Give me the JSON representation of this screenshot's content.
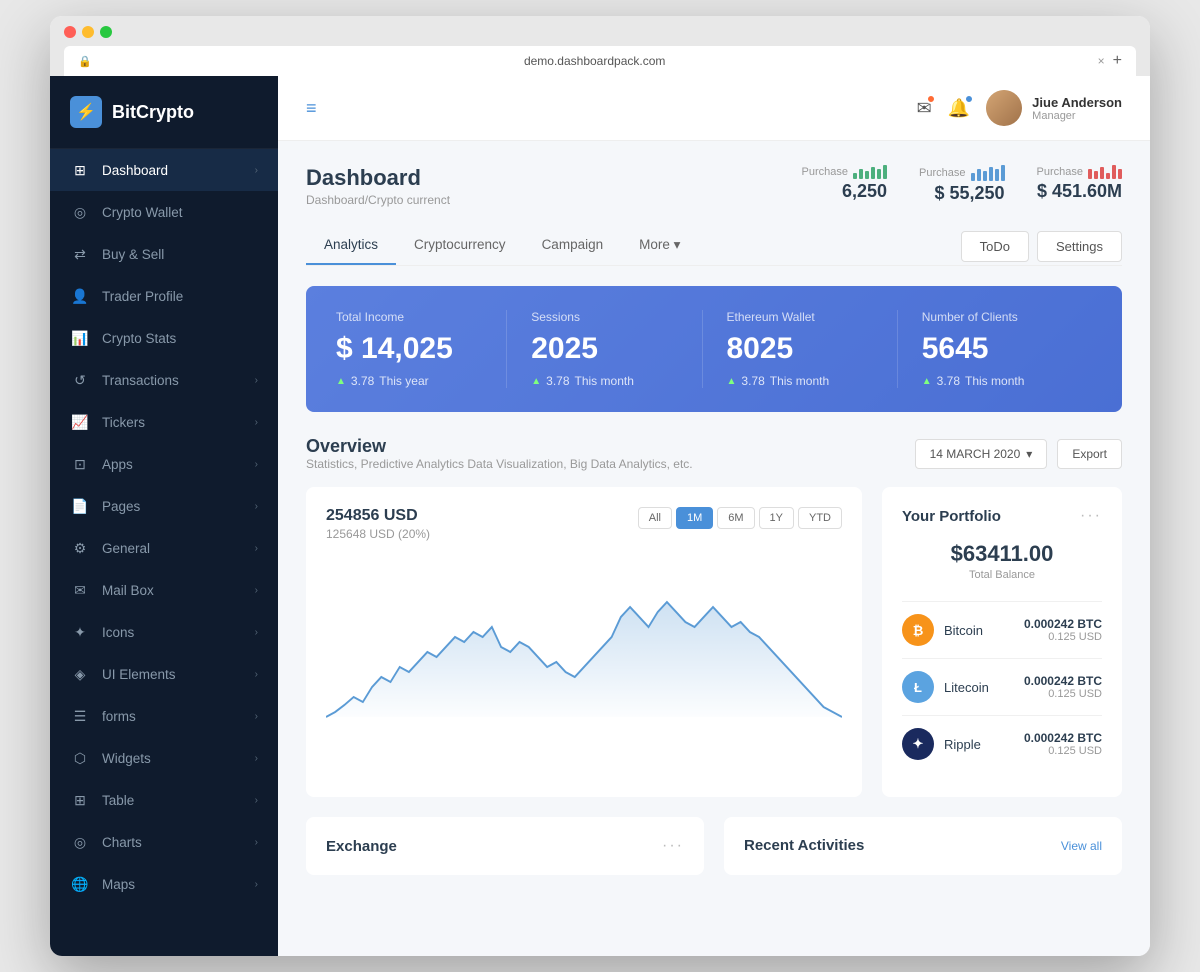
{
  "browser": {
    "url": "demo.dashboardpack.com",
    "close_char": "×",
    "plus_char": "+"
  },
  "sidebar": {
    "logo_text": "BitCrypto",
    "logo_letter": "⚡",
    "items": [
      {
        "id": "dashboard",
        "label": "Dashboard",
        "icon": "⊞",
        "has_arrow": true,
        "active": true
      },
      {
        "id": "crypto-wallet",
        "label": "Crypto Wallet",
        "icon": "◎",
        "has_arrow": false,
        "active": false
      },
      {
        "id": "buy-sell",
        "label": "Buy & Sell",
        "icon": "⇄",
        "has_arrow": false,
        "active": false
      },
      {
        "id": "trader-profile",
        "label": "Trader Profile",
        "icon": "👤",
        "has_arrow": false,
        "active": false
      },
      {
        "id": "crypto-stats",
        "label": "Crypto Stats",
        "icon": "📊",
        "has_arrow": false,
        "active": false
      },
      {
        "id": "transactions",
        "label": "Transactions",
        "icon": "↺",
        "has_arrow": true,
        "active": false
      },
      {
        "id": "tickers",
        "label": "Tickers",
        "icon": "📈",
        "has_arrow": true,
        "active": false
      },
      {
        "id": "apps",
        "label": "Apps",
        "icon": "⊡",
        "has_arrow": true,
        "active": false
      },
      {
        "id": "pages",
        "label": "Pages",
        "icon": "📄",
        "has_arrow": true,
        "active": false
      },
      {
        "id": "general",
        "label": "General",
        "icon": "⚙",
        "has_arrow": true,
        "active": false
      },
      {
        "id": "mail-box",
        "label": "Mail Box",
        "icon": "✉",
        "has_arrow": true,
        "active": false
      },
      {
        "id": "icons",
        "label": "Icons",
        "icon": "✦",
        "has_arrow": true,
        "active": false
      },
      {
        "id": "ui-elements",
        "label": "UI Elements",
        "icon": "◈",
        "has_arrow": true,
        "active": false
      },
      {
        "id": "forms",
        "label": "forms",
        "icon": "☰",
        "has_arrow": true,
        "active": false
      },
      {
        "id": "widgets",
        "label": "Widgets",
        "icon": "⬡",
        "has_arrow": true,
        "active": false
      },
      {
        "id": "table",
        "label": "Table",
        "icon": "⊞",
        "has_arrow": true,
        "active": false
      },
      {
        "id": "charts",
        "label": "Charts",
        "icon": "◎",
        "has_arrow": true,
        "active": false
      },
      {
        "id": "maps",
        "label": "Maps",
        "icon": "🌐",
        "has_arrow": true,
        "active": false
      }
    ]
  },
  "header": {
    "hamburger_icon": "≡",
    "user_name": "Jiue Anderson",
    "user_role": "Manager"
  },
  "page": {
    "title": "Dashboard",
    "breadcrumb": "Dashboard/Crypto currenct"
  },
  "header_stats": [
    {
      "label": "Purchase",
      "value": "6,250",
      "bar_color": "#4caf7d",
      "bars": [
        3,
        5,
        4,
        6,
        5,
        7
      ]
    },
    {
      "label": "Purchase",
      "value": "$ 55,250",
      "bar_color": "#5b9bd5",
      "bars": [
        4,
        6,
        5,
        7,
        6,
        8
      ]
    },
    {
      "label": "Purchase",
      "value": "$ 451.60M",
      "bar_color": "#e05c5c",
      "bars": [
        5,
        4,
        6,
        3,
        7,
        5
      ]
    }
  ],
  "tabs": {
    "items": [
      {
        "id": "analytics",
        "label": "Analytics",
        "active": true
      },
      {
        "id": "cryptocurrency",
        "label": "Cryptocurrency",
        "active": false
      },
      {
        "id": "campaign",
        "label": "Campaign",
        "active": false
      },
      {
        "id": "more",
        "label": "More ▾",
        "active": false
      }
    ],
    "buttons": [
      {
        "id": "todo",
        "label": "ToDo"
      },
      {
        "id": "settings",
        "label": "Settings"
      }
    ]
  },
  "stats_banner": {
    "cards": [
      {
        "id": "total-income",
        "label": "Total Income",
        "value": "$ 14,025",
        "sub": "3.78",
        "period": "This year"
      },
      {
        "id": "sessions",
        "label": "Sessions",
        "value": "2025",
        "sub": "3.78",
        "period": "This month"
      },
      {
        "id": "ethereum",
        "label": "Ethereum Wallet",
        "value": "8025",
        "sub": "3.78",
        "period": "This month"
      },
      {
        "id": "clients",
        "label": "Number of Clients",
        "value": "5645",
        "sub": "3.78",
        "period": "This month"
      }
    ]
  },
  "overview": {
    "title": "Overview",
    "subtitle": "Statistics, Predictive Analytics Data Visualization, Big Data Analytics, etc.",
    "date": "14 MARCH 2020",
    "export_label": "Export",
    "chart": {
      "value": "254856 USD",
      "sub": "125648 USD (20%)",
      "period_buttons": [
        "All",
        "1M",
        "6M",
        "1Y",
        "YTD"
      ],
      "active_period": "1M"
    }
  },
  "portfolio": {
    "title": "Your Portfolio",
    "balance": "$63411.00",
    "balance_label": "Total Balance",
    "items": [
      {
        "id": "bitcoin",
        "label": "Bitcoin",
        "icon": "₿",
        "color": "#f7931a",
        "amount": "0.000242 BTC",
        "usd": "0.125 USD"
      },
      {
        "id": "litecoin",
        "label": "Litecoin",
        "icon": "Ł",
        "color": "#5ba3e0",
        "amount": "0.000242 BTC",
        "usd": "0.125 USD"
      },
      {
        "id": "ripple",
        "label": "Ripple",
        "icon": "✦",
        "color": "#1a2a5e",
        "amount": "0.000242 BTC",
        "usd": "0.125 USD"
      }
    ]
  },
  "bottom": {
    "exchange_title": "Exchange",
    "activities_title": "Recent Activities",
    "view_all": "View all",
    "dots": "···"
  }
}
